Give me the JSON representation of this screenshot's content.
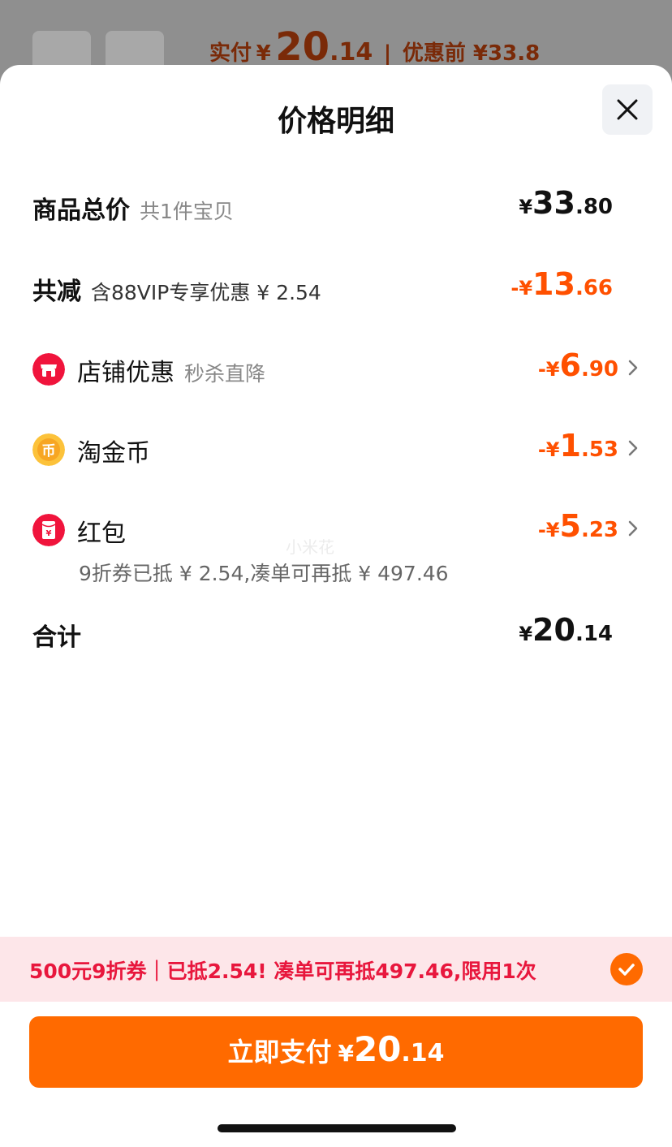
{
  "background": {
    "actual_pay_label": "实付",
    "actual_pay_currency": "¥",
    "actual_pay_int": "20",
    "actual_pay_dec": ".14",
    "separator": "|",
    "before_discount": "优惠前 ¥33.8"
  },
  "sheet": {
    "title": "价格明细",
    "close_icon": "close-icon"
  },
  "rows": {
    "total": {
      "label": "商品总价",
      "sub": "共1件宝贝",
      "currency": "¥",
      "int": "33",
      "dec": ".80"
    },
    "reduction": {
      "label": "共减",
      "sub": "含88VIP专享优惠 ¥ 2.54",
      "currency": "-¥",
      "int": "13",
      "dec": ".66"
    },
    "store": {
      "icon": "store-icon",
      "label": "店铺优惠",
      "sub": "秒杀直降",
      "currency": "-¥",
      "int": "6",
      "dec": ".90"
    },
    "coins": {
      "icon": "gold-coin-icon",
      "label": "淘金币",
      "currency": "-¥",
      "int": "1",
      "dec": ".53"
    },
    "redpacket": {
      "icon": "red-packet-icon",
      "label": "红包",
      "note": "9折券已抵 ¥ 2.54,凑单可再抵 ¥ 497.46",
      "currency": "-¥",
      "int": "5",
      "dec": ".23"
    },
    "sum": {
      "label": "合计",
      "currency": "¥",
      "int": "20",
      "dec": ".14"
    }
  },
  "watermark": "小米花",
  "promo": {
    "text": "500元9折券｜已抵2.54! 凑单可再抵497.46,限用1次",
    "checked": true
  },
  "pay_button": {
    "label": "立即支付",
    "currency": "¥",
    "int": "20",
    "dec": ".14"
  },
  "colors": {
    "accent": "#ff6a00",
    "discount": "#ff5000",
    "promo_bg": "#fde6e9",
    "promo_text": "#e8173d"
  }
}
